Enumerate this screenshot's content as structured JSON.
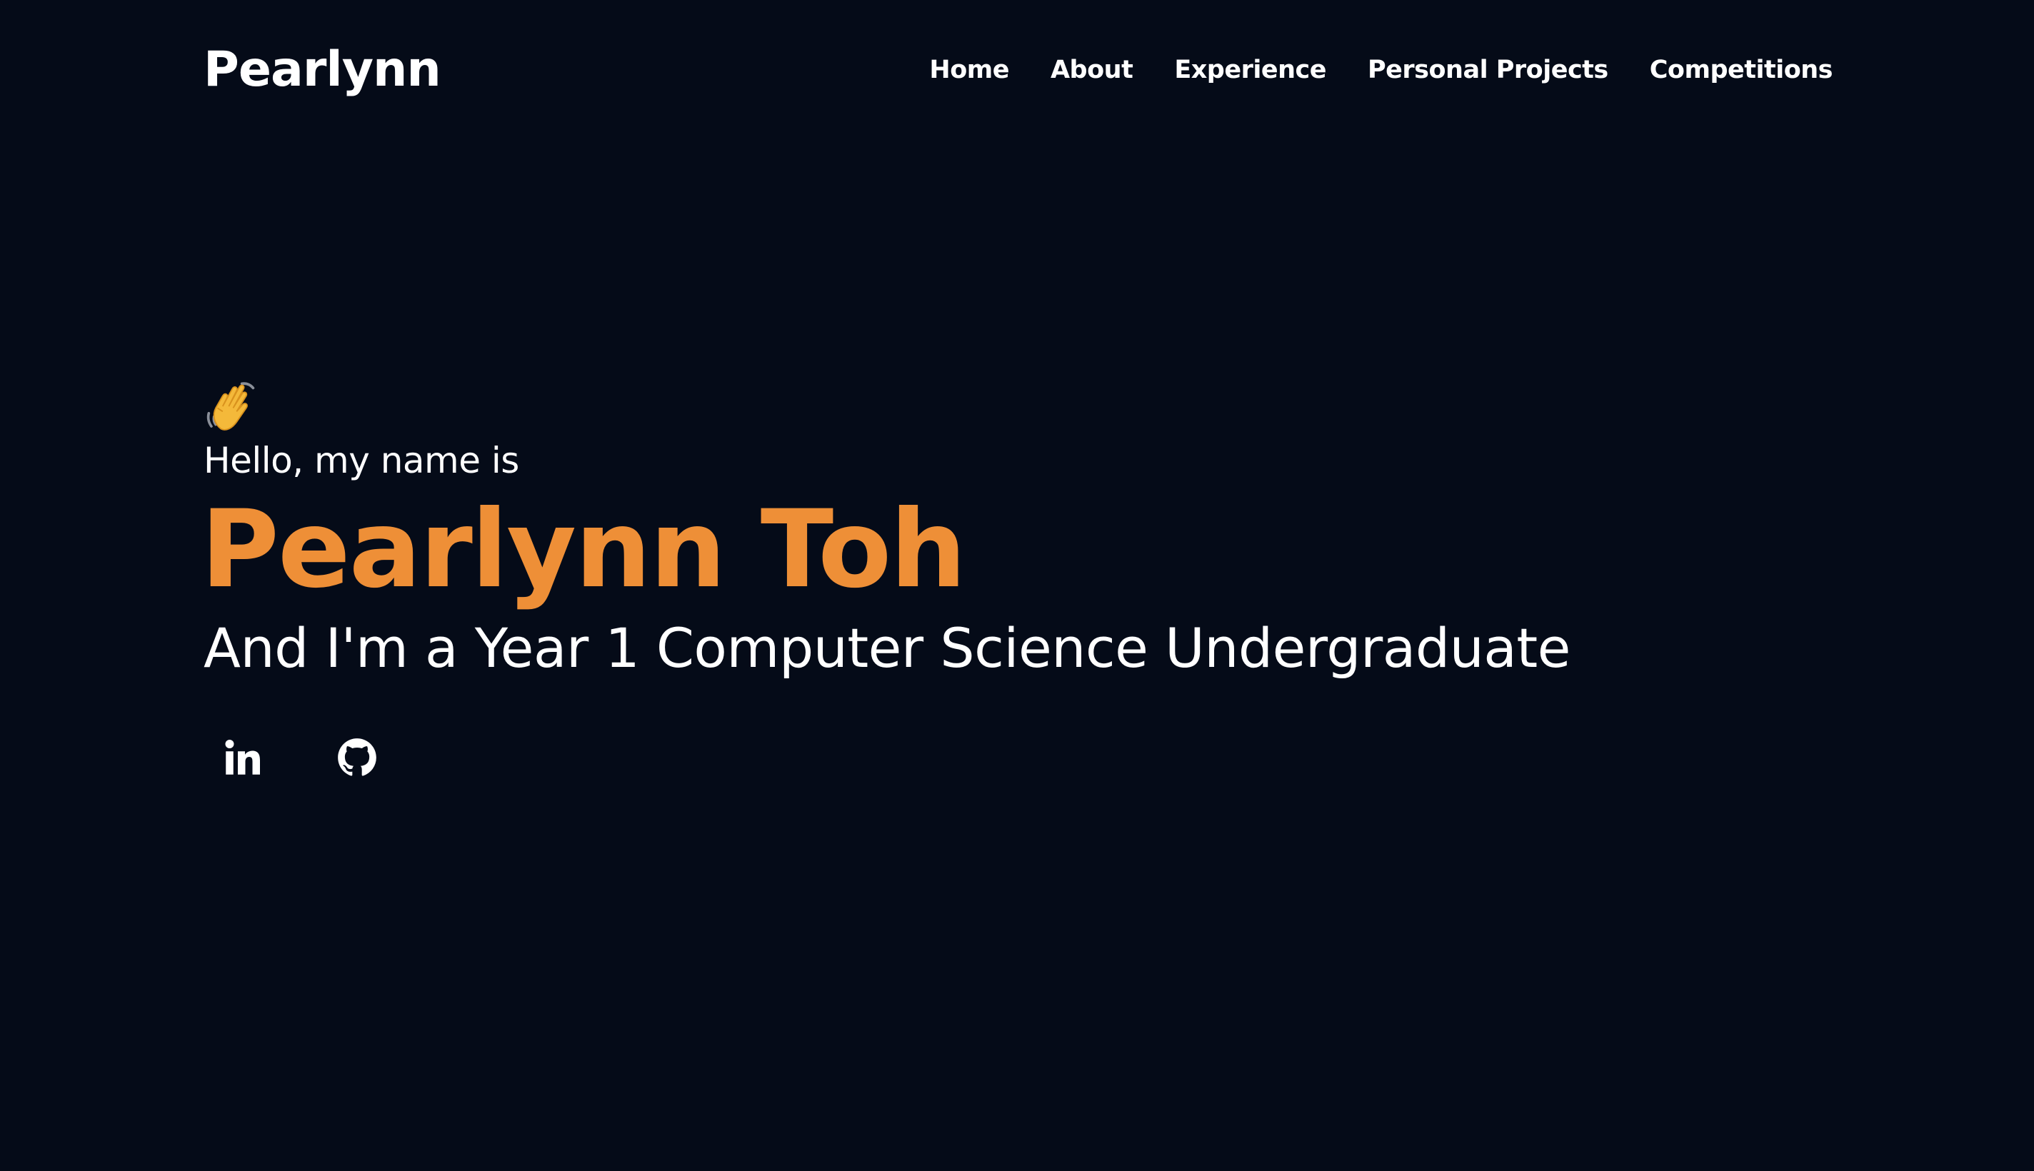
{
  "brand": {
    "name": "Pearlynn"
  },
  "nav": {
    "items": [
      {
        "label": "Home"
      },
      {
        "label": "About"
      },
      {
        "label": "Experience"
      },
      {
        "label": "Personal Projects"
      },
      {
        "label": "Competitions"
      }
    ]
  },
  "hero": {
    "wave_icon": "waving-hand-emoji",
    "greeting": "Hello, my name is",
    "name": "Pearlynn Toh",
    "subtitle": "And I'm a Year 1 Computer Science Undergraduate"
  },
  "socials": [
    {
      "icon": "linkedin-icon"
    },
    {
      "icon": "github-icon"
    }
  ],
  "colors": {
    "background": "#050b18",
    "accent": "#ee8f37",
    "text": "#ffffff"
  }
}
